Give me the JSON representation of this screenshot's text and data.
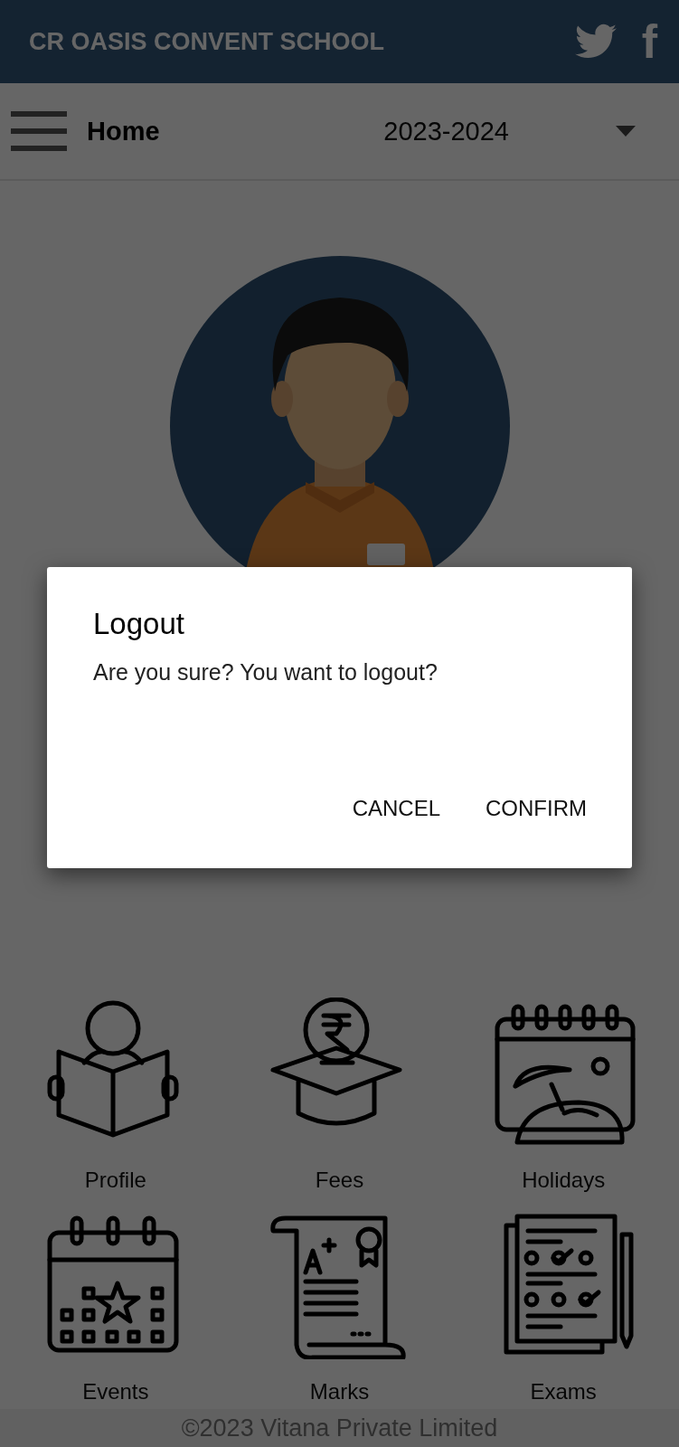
{
  "header": {
    "title": "CR OASIS CONVENT SCHOOL",
    "facebook_glyph": "f"
  },
  "toolbar": {
    "title": "Home",
    "year_select": {
      "value": "2023-2024"
    }
  },
  "tiles": [
    {
      "label": "Profile",
      "kind": "reader"
    },
    {
      "label": "Fees",
      "kind": "fees"
    },
    {
      "label": "Holidays",
      "kind": "holiday"
    },
    {
      "label": "Events",
      "kind": "events"
    },
    {
      "label": "Marks",
      "kind": "marks"
    },
    {
      "label": "Exams",
      "kind": "exams"
    }
  ],
  "dialog": {
    "title": "Logout",
    "message": "Are you sure? You want to logout?",
    "buttons": [
      "CANCEL",
      "CONFIRM"
    ]
  },
  "footer": "©2023 Vitana Private Limited"
}
